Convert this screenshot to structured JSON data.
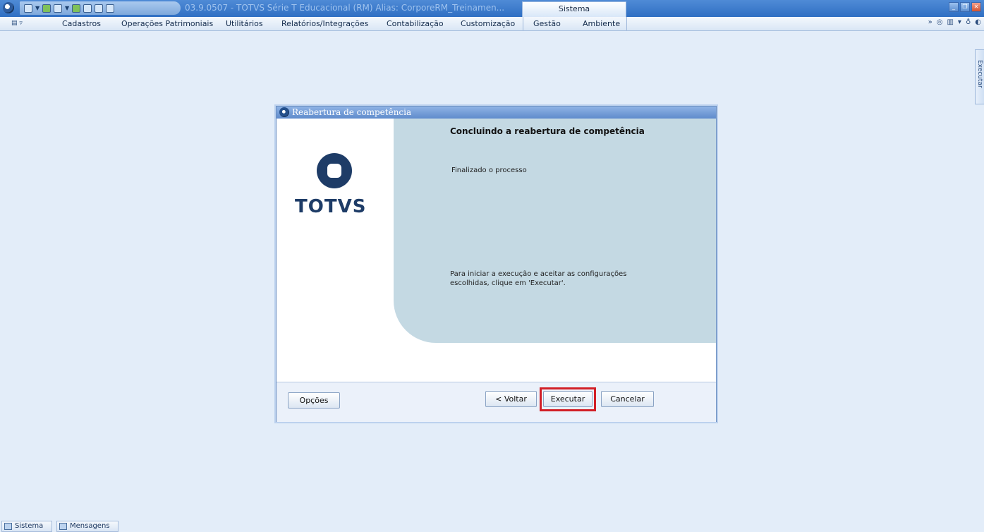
{
  "window": {
    "title": "03.9.0507 - TOTVS Série T Educacional (RM) Alias: CorporeRM_Treinamen...",
    "active_tab": "Sistema"
  },
  "menu": {
    "items": [
      "Cadastros",
      "Operações Patrimoniais",
      "Utilitários",
      "Relatórios/Integrações",
      "Contabilização",
      "Customização",
      "Gestão",
      "Ambiente"
    ]
  },
  "side_panel": {
    "label": "Executar"
  },
  "dialog": {
    "title": "Reabertura de competência",
    "logo_text": "TOTVS",
    "heading": "Concluindo a reabertura de competência",
    "status": "Finalizado o processo",
    "instructions": "Para iniciar a execução e aceitar as configurações escolhidas, clique em 'Executar'.",
    "buttons": {
      "options": "Opções",
      "back": "< Voltar",
      "execute": "Executar",
      "cancel": "Cancelar"
    },
    "highlight_color": "#d21f26"
  },
  "taskbar": {
    "items": [
      "Sistema",
      "Mensagens"
    ]
  }
}
